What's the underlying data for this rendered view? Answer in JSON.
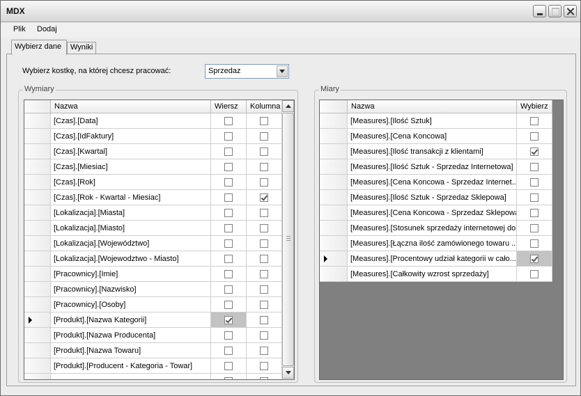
{
  "window": {
    "title": "MDX"
  },
  "menu": [
    "Plik",
    "Dodaj"
  ],
  "tabs": [
    {
      "label": "Wybierz dane",
      "active": true
    },
    {
      "label": "Wyniki",
      "active": false
    }
  ],
  "cube_selector": {
    "label": "Wybierz kostkę, na której chcesz pracować:",
    "value": "Sprzedaz"
  },
  "dimensions": {
    "group_label": "Wymiary",
    "columns": [
      "Nazwa",
      "Wiersz",
      "Kolumna"
    ],
    "rows": [
      {
        "name": "[Czas].[Data]",
        "wiersz": false,
        "kolumna": false
      },
      {
        "name": "[Czas].[IdFaktury]",
        "wiersz": false,
        "kolumna": false
      },
      {
        "name": "[Czas].[Kwartal]",
        "wiersz": false,
        "kolumna": false
      },
      {
        "name": "[Czas].[Miesiac]",
        "wiersz": false,
        "kolumna": false
      },
      {
        "name": "[Czas].[Rok]",
        "wiersz": false,
        "kolumna": false
      },
      {
        "name": "[Czas].[Rok -  Kwartal -  Miesiac]",
        "wiersz": false,
        "kolumna": true
      },
      {
        "name": "[Lokalizacja].[Miasta]",
        "wiersz": false,
        "kolumna": false
      },
      {
        "name": "[Lokalizacja].[Miasto]",
        "wiersz": false,
        "kolumna": false
      },
      {
        "name": "[Lokalizacja].[Województwo]",
        "wiersz": false,
        "kolumna": false
      },
      {
        "name": "[Lokalizacja].[Wojewodztwo - Miasto]",
        "wiersz": false,
        "kolumna": false
      },
      {
        "name": "[Pracownicy].[Imie]",
        "wiersz": false,
        "kolumna": false
      },
      {
        "name": "[Pracownicy].[Nazwisko]",
        "wiersz": false,
        "kolumna": false
      },
      {
        "name": "[Pracownicy].[Osoby]",
        "wiersz": false,
        "kolumna": false
      },
      {
        "name": "[Produkt].[Nazwa Kategorii]",
        "wiersz": true,
        "kolumna": false,
        "current": true
      },
      {
        "name": "[Produkt].[Nazwa Producenta]",
        "wiersz": false,
        "kolumna": false
      },
      {
        "name": "[Produkt].[Nazwa Towaru]",
        "wiersz": false,
        "kolumna": false
      },
      {
        "name": "[Produkt].[Producent - Kategoria - Towar]",
        "wiersz": false,
        "kolumna": false
      },
      {
        "name": "",
        "wiersz": false,
        "kolumna": false
      }
    ]
  },
  "measures": {
    "group_label": "Miary",
    "columns": [
      "Nazwa",
      "Wybierz"
    ],
    "rows": [
      {
        "name": "[Measures].[Ilość Sztuk]",
        "wybierz": false
      },
      {
        "name": "[Measures].[Cena Koncowa]",
        "wybierz": false
      },
      {
        "name": "[Measures].[Ilość transakcji z klientami]",
        "wybierz": true
      },
      {
        "name": "[Measures].[Ilość Sztuk - Sprzedaz Internetowa]",
        "wybierz": false
      },
      {
        "name": "[Measures].[Cena Koncowa - Sprzedaz Internet...",
        "wybierz": false
      },
      {
        "name": "[Measures].[Ilość Sztuk - Sprzedaz Sklepowa]",
        "wybierz": false
      },
      {
        "name": "[Measures].[Cena Koncowa - Sprzedaz Sklepowa]",
        "wybierz": false
      },
      {
        "name": "[Measures].[Stosunek sprzedaży internetowej do...",
        "wybierz": false
      },
      {
        "name": "[Measures].[Łączna ilość zamówionego towaru ...",
        "wybierz": false
      },
      {
        "name": "[Measures].[Procentowy udział kategorii w cało...",
        "wybierz": true,
        "current": true
      },
      {
        "name": "[Measures].[Całkowity wzrost sprzedaży]",
        "wybierz": false
      }
    ]
  }
}
